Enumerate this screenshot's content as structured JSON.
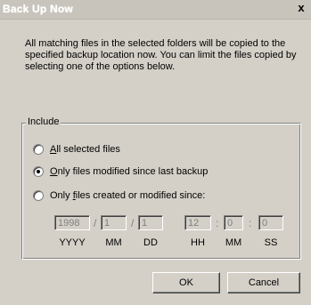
{
  "window": {
    "title": "Back Up Now",
    "close_glyph": "x"
  },
  "description": "All matching files in the selected folders will be copied to the specified backup location now.  You can limit the files copied by selecting one of the options below.",
  "include": {
    "legend": "Include",
    "options": [
      {
        "access_key": "A",
        "label_rest": "ll selected files",
        "checked": false
      },
      {
        "access_key": "O",
        "label_rest": "nly files modified since last backup",
        "checked": true
      },
      {
        "label_start": "Only ",
        "access_key": "f",
        "label_rest": "iles created or modified since:",
        "checked": false
      }
    ]
  },
  "datetime": {
    "year": "1998",
    "month": "1",
    "day": "1",
    "hour": "12",
    "minute": "0",
    "second": "0",
    "date_sep": "/",
    "time_sep": ":",
    "units": [
      "YYYY",
      "MM",
      "DD",
      "HH",
      "MM",
      "SS"
    ]
  },
  "buttons": {
    "ok": "OK",
    "cancel": "Cancel"
  }
}
